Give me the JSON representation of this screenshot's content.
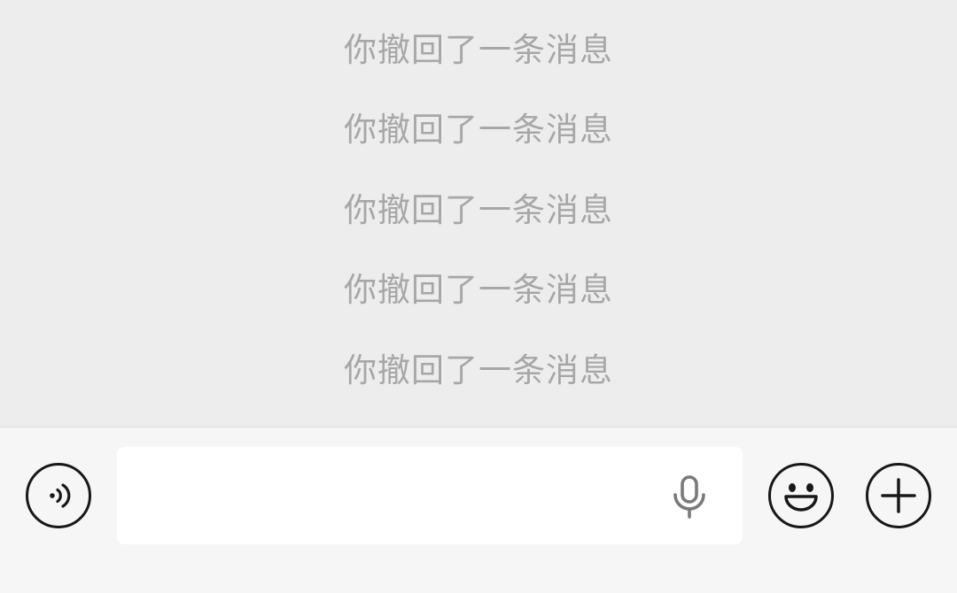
{
  "chat": {
    "system_messages": [
      "你撤回了一条消息",
      "你撤回了一条消息",
      "你撤回了一条消息",
      "你撤回了一条消息",
      "你撤回了一条消息"
    ]
  },
  "input_bar": {
    "left_icon": "voice-mode-icon",
    "field_icon": "microphone-icon",
    "emoji_icon": "emoji-icon",
    "plus_icon": "plus-icon",
    "message_value": ""
  },
  "colors": {
    "chat_background": "#ededed",
    "input_bar_background": "#f6f6f6",
    "system_text": "#a7a7a7",
    "icon_stroke": "#181818",
    "mic_color": "#7a7a7a"
  }
}
